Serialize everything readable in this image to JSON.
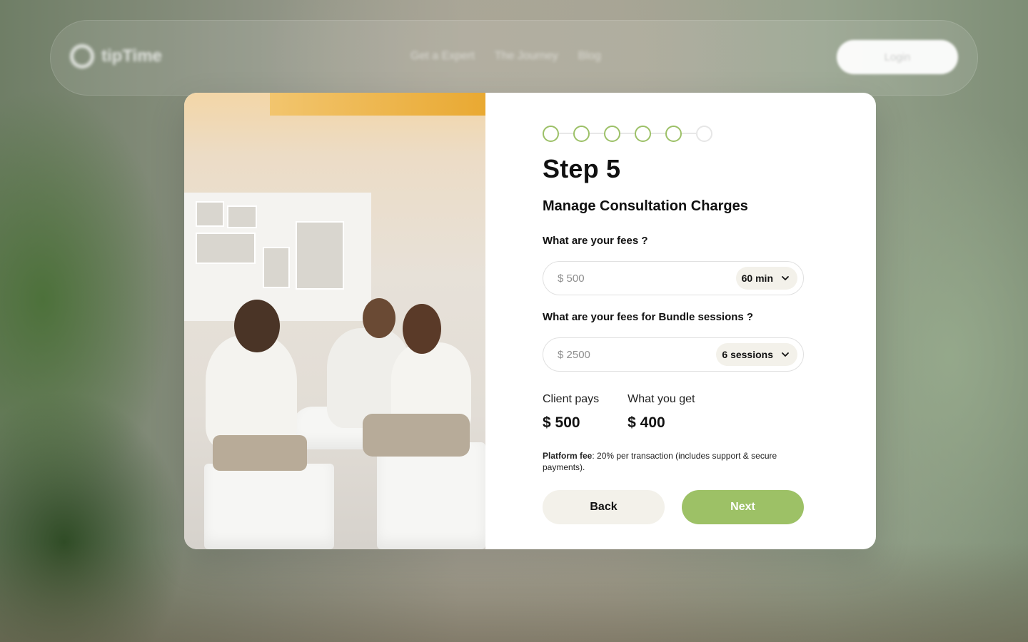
{
  "background": {
    "logo_text": "tipTime",
    "nav_links": [
      "Get a Expert",
      "The Journey",
      "Blog"
    ],
    "login_label": "Login"
  },
  "colors": {
    "accent": "#9dc166",
    "pill_bg": "#f3f1ea",
    "inactive_dot": "#e6e6e6"
  },
  "progress": {
    "total_steps": 6,
    "completed_steps": 5
  },
  "step": {
    "title": "Step 5",
    "subtitle": "Manage Consultation Charges"
  },
  "fees": {
    "question": "What are your fees ?",
    "value": "$ 500",
    "duration": "60 min"
  },
  "bundle": {
    "question": "What are your fees for Bundle sessions ?",
    "value": "$ 2500",
    "sessions": "6 sessions"
  },
  "summary": {
    "client_label": "Client pays",
    "client_amount": "$ 500",
    "you_label": "What you get",
    "you_amount": "$ 400"
  },
  "platform_fee": {
    "label": "Platform fee",
    "text": ": 20% per transaction (includes support & secure payments)."
  },
  "buttons": {
    "back": "Back",
    "next": "Next"
  },
  "icons": {
    "dropdown": "chevron-down-icon"
  }
}
